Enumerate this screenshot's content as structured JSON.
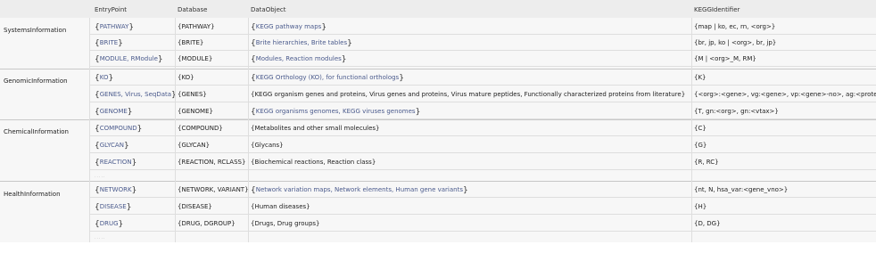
{
  "columns": [
    "EntryPoint",
    "Database",
    "DataObject",
    "KEGGIdentifier"
  ],
  "groups": [
    {
      "label": "SystemsInformation",
      "more": false,
      "rows": [
        {
          "entry": "PATHWAY",
          "database": "{PATHWAY}",
          "object": "KEGG pathway maps",
          "identifier": "{map | ko, ec, rn, <org>}"
        },
        {
          "entry": "BRITE",
          "database": "{BRITE}",
          "object": "Brite hierarchies, Brite tables",
          "identifier": "{br, jp, ko | <org>, br, jp}"
        },
        {
          "entry": "MODULE, RModule",
          "database": "{MODULE}",
          "object": "Modules, Reaction modules",
          "identifier": "{M | <org>_M, RM}"
        }
      ]
    },
    {
      "label": "GenomicInformation",
      "more": false,
      "rows": [
        {
          "entry": "KO",
          "database": "{KO}",
          "object": "KEGG Orthology (KO), for functional orthologs",
          "identifier": "{K}"
        },
        {
          "entry": "GENES, Virus, SeqData",
          "database": "{GENES}",
          "object": "{KEGG organism genes and proteins, Virus genes and proteins, Virus mature peptides, Functionally characterized proteins from literature}",
          "identifier": "{<org>:<gene>, vg:<gene>, vp:<gene>-no>, ag:<protein>}"
        },
        {
          "entry": "GENOME",
          "database": "{GENOME}",
          "object": "KEGG organisms genomes, KEGG viruses genomes",
          "identifier": "{T, gn:<org>, gn:<vtax>}"
        }
      ]
    },
    {
      "label": "ChemicalInformation",
      "more": true,
      "rows": [
        {
          "entry": "COMPOUND",
          "database": "{COMPOUND}",
          "object": "{Metabolites and other small molecules}",
          "identifier": "{C}"
        },
        {
          "entry": "GLYCAN",
          "database": "{GLYCAN}",
          "object": "{Glycans}",
          "identifier": "{G}"
        },
        {
          "entry": "REACTION",
          "database": "{REACTION, RCLASS}",
          "object": "{Biochemical reactions, Reaction class}",
          "identifier": "{R, RC}"
        }
      ]
    },
    {
      "label": "HealthInformation",
      "more": true,
      "rows": [
        {
          "entry": "NETWORK",
          "database": "{NETWORK, VARIANT}",
          "object": "Network variation maps, Network elements, Human gene variants",
          "identifier": "{nt, N, hsa_var:<gene_vno>}"
        },
        {
          "entry": "DISEASE",
          "database": "{DISEASE}",
          "object": "{Human diseases}",
          "identifier": "{H}"
        },
        {
          "entry": "DRUG",
          "database": "{DRUG, DGROUP}",
          "object": "{Drugs, Drug groups}",
          "identifier": "{D, DG}"
        }
      ]
    }
  ],
  "more_text": "· · · · ·",
  "colors": {
    "link": "#4a5a8c",
    "header": "#ededed",
    "grid": "#dedede"
  }
}
